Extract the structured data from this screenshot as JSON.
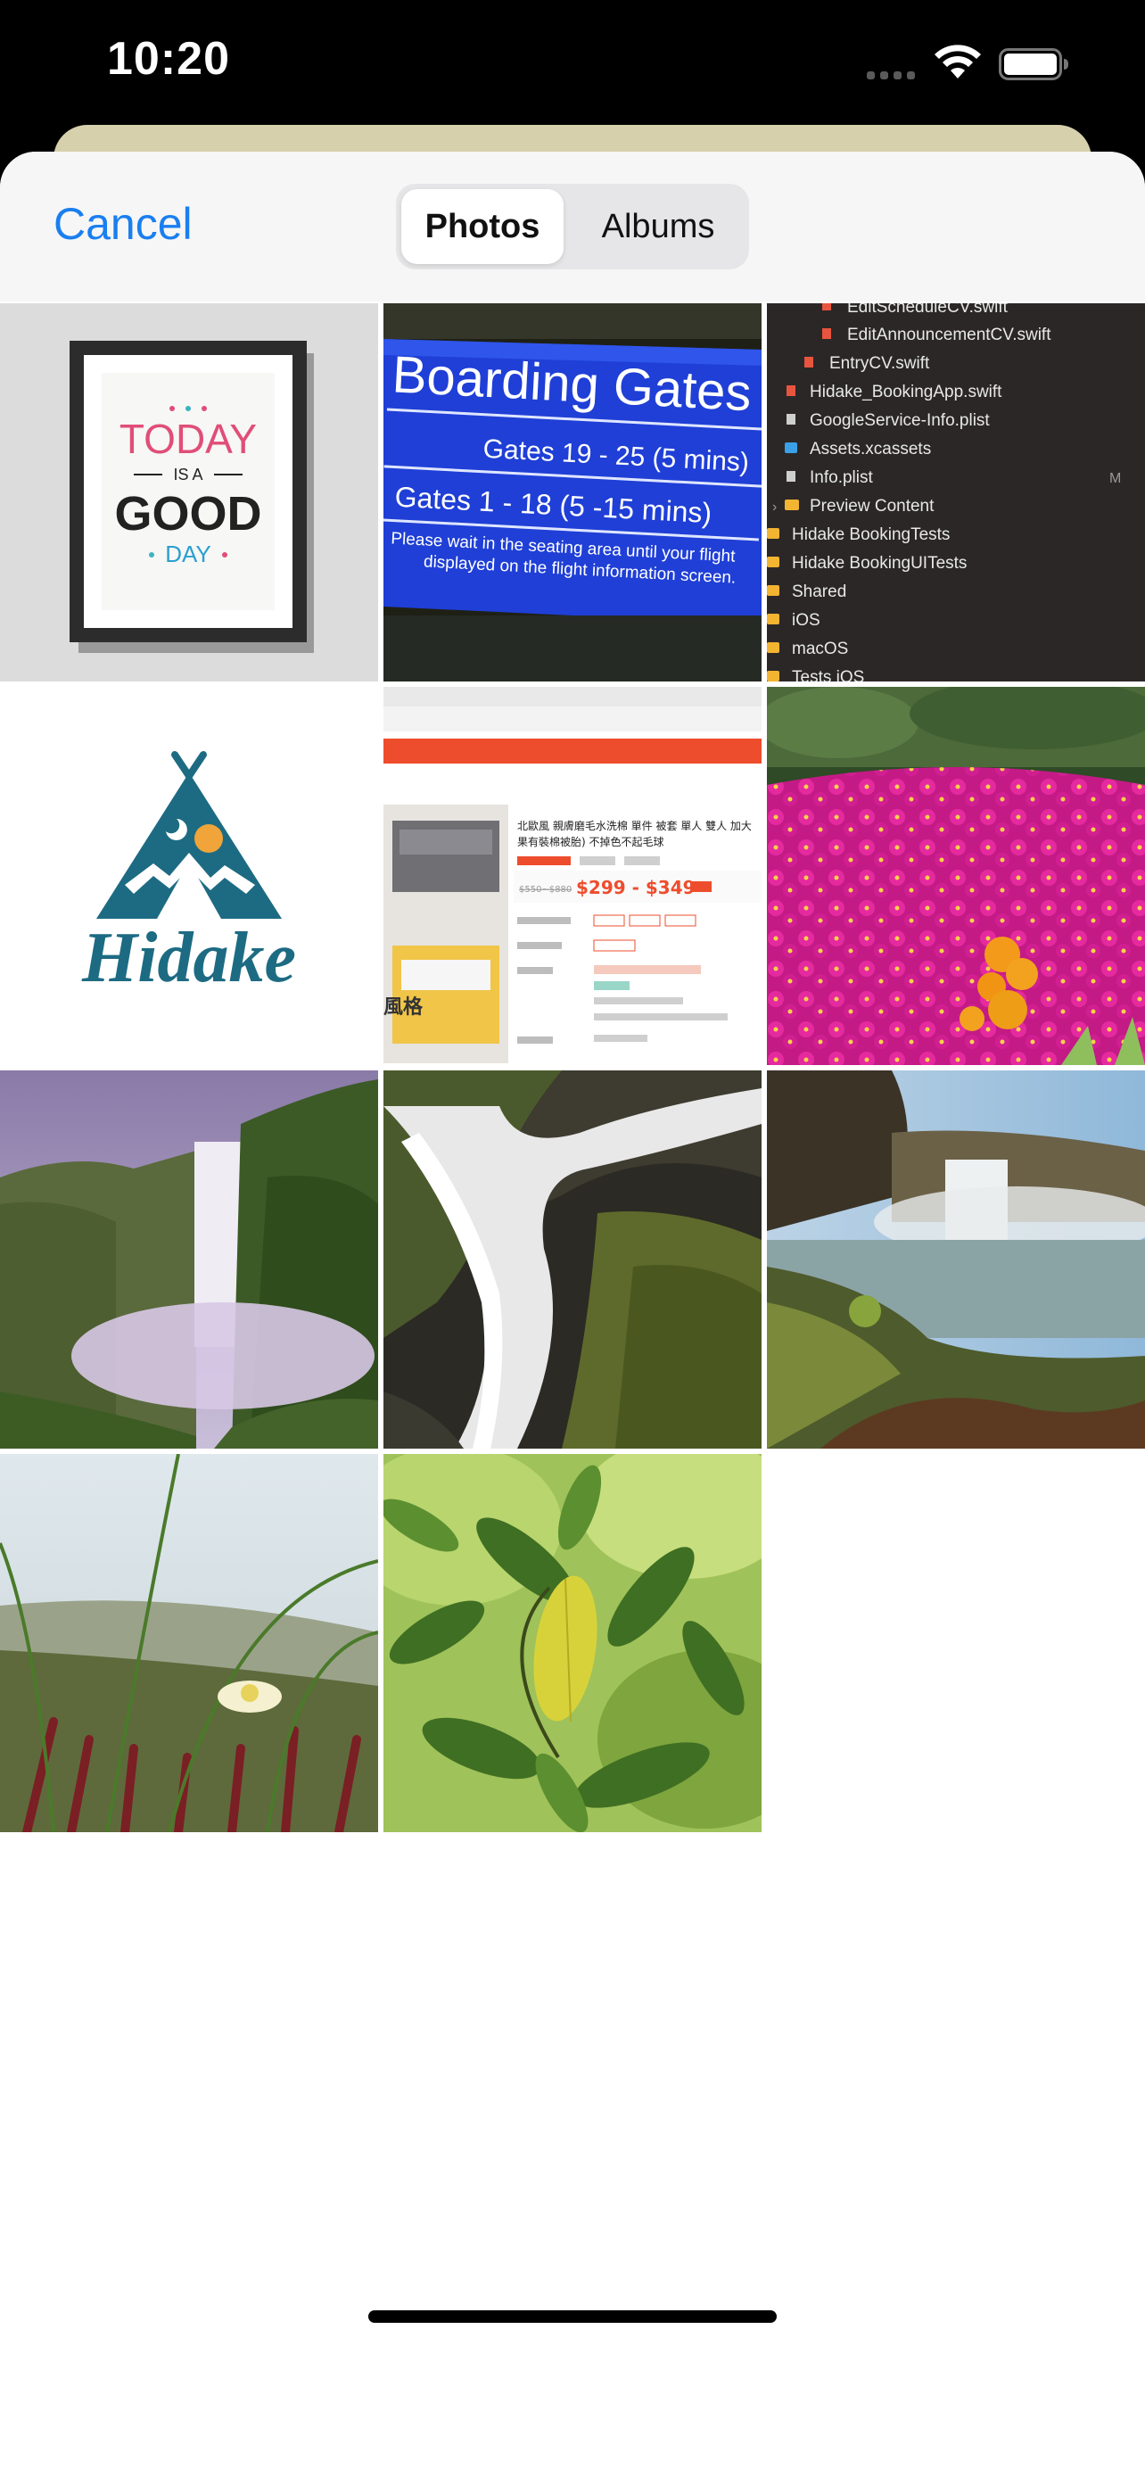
{
  "status_bar": {
    "time": "10:20"
  },
  "nav": {
    "cancel_label": "Cancel"
  },
  "segments": {
    "photos": "Photos",
    "albums": "Albums",
    "selected": "Photos"
  },
  "photos": {
    "poster": {
      "line1": "TODAY",
      "line2": "IS A",
      "line3": "GOOD",
      "line4": "DAY"
    },
    "boarding": {
      "title": "Boarding Gates",
      "line1": "Gates 19 - 25 (5 mins)",
      "line2": "Gates 1 - 18 (5 -15 mins)",
      "line3": "Please wait in the seating area until your flight",
      "line4": "displayed on the flight information screen."
    },
    "files": [
      "EditScheduleCV.swift",
      "EditAnnouncementCV.swift",
      "EntryCV.swift",
      "Hidake_BookingApp.swift",
      "GoogleService-Info.plist",
      "Assets.xcassets",
      "Info.plist",
      "Preview Content",
      "Hidake BookingTests",
      "Hidake BookingUITests",
      "Shared",
      "iOS",
      "macOS",
      "Tests iOS"
    ],
    "files_badge": "M",
    "logo_text": "Hidake",
    "shop": {
      "title": "北歐風 親膚磨毛水洗棉 單件 被套 單人 雙人 加大",
      "subtitle": "果有裝棉被胎) 不掉色不起毛球",
      "price_old": "$550~$880",
      "price": "$299 - $349",
      "side_label": "風格"
    }
  }
}
